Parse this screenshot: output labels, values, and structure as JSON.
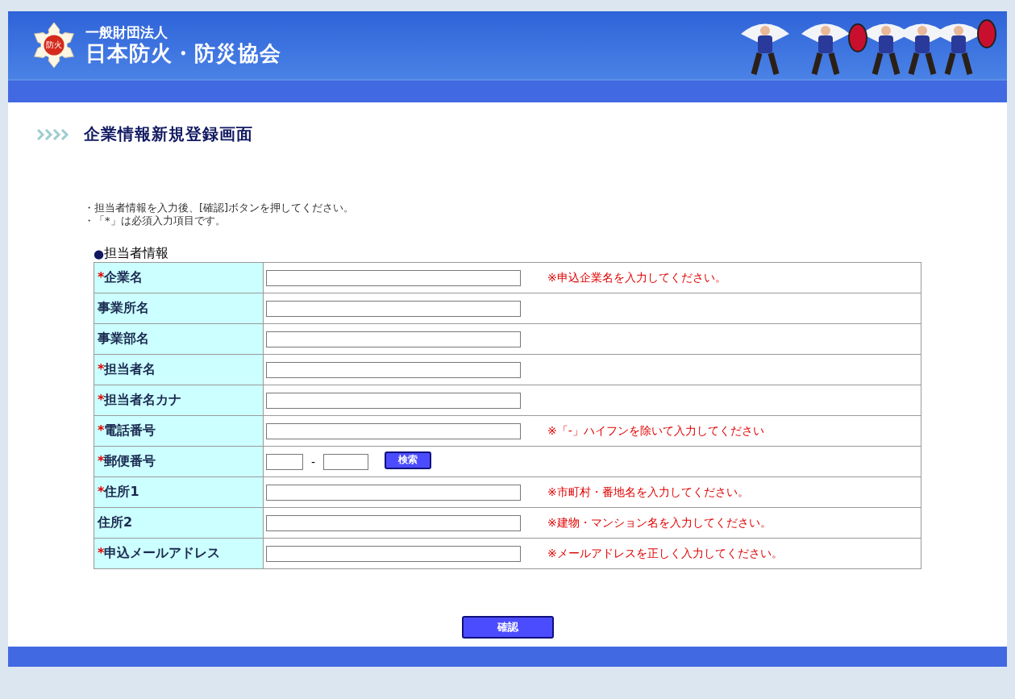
{
  "header": {
    "emblem": "防火",
    "org_type": "一般財団法人",
    "org_name": "日本防火・防災協会"
  },
  "page_title": "企業情報新規登録画面",
  "instructions": [
    "・担当者情報を入力後、[確認]ボタンを押してください。",
    "・「*」は必須入力項目です。"
  ],
  "section": {
    "bullet": "●",
    "title": "担当者情報"
  },
  "rows": [
    {
      "kind": "text",
      "label": "企業名",
      "required": true,
      "hint": "※申込企業名を入力してください。"
    },
    {
      "kind": "text",
      "label": "事業所名",
      "required": false
    },
    {
      "kind": "text",
      "label": "事業部名",
      "required": false
    },
    {
      "kind": "text",
      "label": "担当者名",
      "required": true
    },
    {
      "kind": "text",
      "label": "担当者名カナ",
      "required": true
    },
    {
      "kind": "text",
      "label": "電話番号",
      "required": true,
      "hint": "※「-」ハイフンを除いて入力してください"
    },
    {
      "kind": "postal",
      "label": "郵便番号",
      "required": true,
      "separator": "-",
      "button": "検索"
    },
    {
      "kind": "text",
      "label": "住所1",
      "required": true,
      "hint": "※市町村・番地名を入力してください。"
    },
    {
      "kind": "text",
      "label": "住所2",
      "required": false,
      "hint": "※建物・マンション名を入力してください。"
    },
    {
      "kind": "text",
      "label": "申込メールアドレス",
      "required": true,
      "hint": "※メールアドレスを正しく入力してください。"
    }
  ],
  "required_mark": "*",
  "confirm_button": "確認"
}
